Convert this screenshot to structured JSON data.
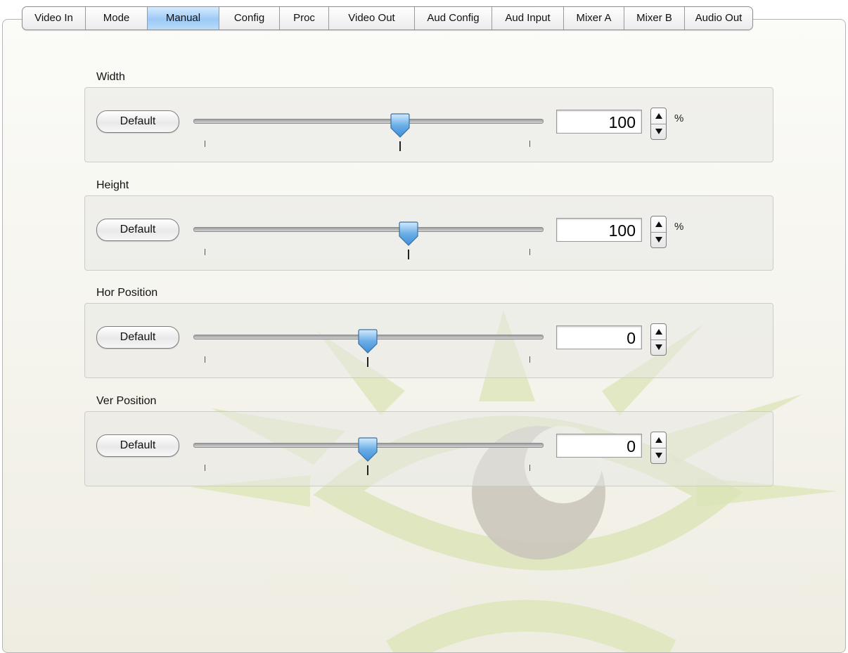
{
  "tabs": [
    {
      "label": "Video In",
      "selected": false
    },
    {
      "label": "Mode",
      "selected": false
    },
    {
      "label": "Manual",
      "selected": true
    },
    {
      "label": "Config",
      "selected": false
    },
    {
      "label": "Proc",
      "selected": false
    },
    {
      "label": "Video Out",
      "selected": false
    },
    {
      "label": "Aud Config",
      "selected": false
    },
    {
      "label": "Aud Input",
      "selected": false
    },
    {
      "label": "Mixer A",
      "selected": false
    },
    {
      "label": "Mixer B",
      "selected": false
    },
    {
      "label": "Audio Out",
      "selected": false
    }
  ],
  "controls": [
    {
      "label": "Width",
      "button": "Default",
      "value": "100",
      "unit": "%",
      "slider_fraction": 0.6
    },
    {
      "label": "Height",
      "button": "Default",
      "value": "100",
      "unit": "%",
      "slider_fraction": 0.625
    },
    {
      "label": "Hor Position",
      "button": "Default",
      "value": "0",
      "unit": "",
      "slider_fraction": 0.5
    },
    {
      "label": "Ver Position",
      "button": "Default",
      "value": "0",
      "unit": "",
      "slider_fraction": 0.5
    }
  ],
  "icons": {
    "stepper_up": "up-arrow-icon",
    "stepper_down": "down-arrow-icon"
  },
  "colors": {
    "selected_tab": "#a9d1f7",
    "thumb": "#6aaee6",
    "watermark_green": "#d9e4b4",
    "watermark_gray": "#cfcac0"
  }
}
